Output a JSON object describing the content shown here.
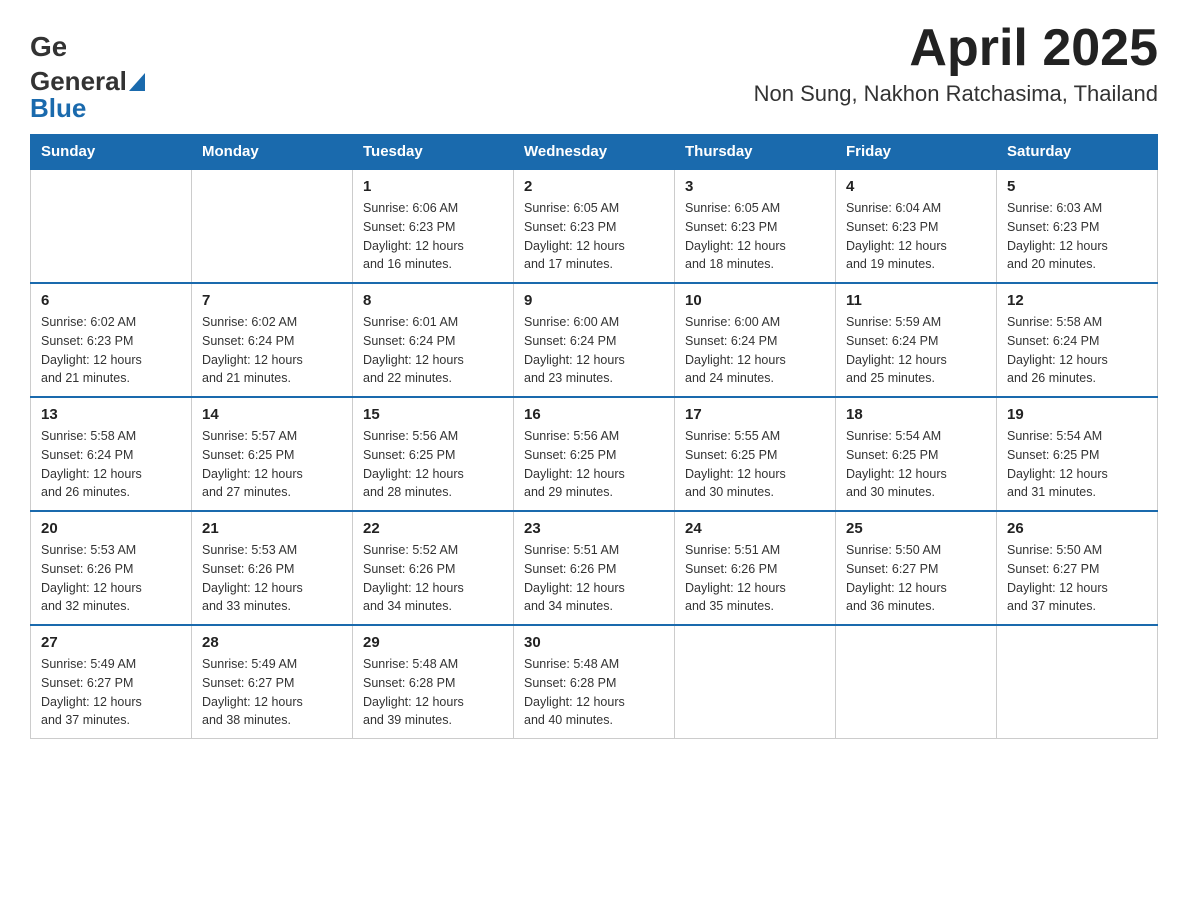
{
  "header": {
    "logo_general": "General",
    "logo_blue": "Blue",
    "title": "April 2025",
    "subtitle": "Non Sung, Nakhon Ratchasima, Thailand"
  },
  "calendar": {
    "headers": [
      "Sunday",
      "Monday",
      "Tuesday",
      "Wednesday",
      "Thursday",
      "Friday",
      "Saturday"
    ],
    "weeks": [
      [
        {
          "day": "",
          "info": ""
        },
        {
          "day": "",
          "info": ""
        },
        {
          "day": "1",
          "info": "Sunrise: 6:06 AM\nSunset: 6:23 PM\nDaylight: 12 hours\nand 16 minutes."
        },
        {
          "day": "2",
          "info": "Sunrise: 6:05 AM\nSunset: 6:23 PM\nDaylight: 12 hours\nand 17 minutes."
        },
        {
          "day": "3",
          "info": "Sunrise: 6:05 AM\nSunset: 6:23 PM\nDaylight: 12 hours\nand 18 minutes."
        },
        {
          "day": "4",
          "info": "Sunrise: 6:04 AM\nSunset: 6:23 PM\nDaylight: 12 hours\nand 19 minutes."
        },
        {
          "day": "5",
          "info": "Sunrise: 6:03 AM\nSunset: 6:23 PM\nDaylight: 12 hours\nand 20 minutes."
        }
      ],
      [
        {
          "day": "6",
          "info": "Sunrise: 6:02 AM\nSunset: 6:23 PM\nDaylight: 12 hours\nand 21 minutes."
        },
        {
          "day": "7",
          "info": "Sunrise: 6:02 AM\nSunset: 6:24 PM\nDaylight: 12 hours\nand 21 minutes."
        },
        {
          "day": "8",
          "info": "Sunrise: 6:01 AM\nSunset: 6:24 PM\nDaylight: 12 hours\nand 22 minutes."
        },
        {
          "day": "9",
          "info": "Sunrise: 6:00 AM\nSunset: 6:24 PM\nDaylight: 12 hours\nand 23 minutes."
        },
        {
          "day": "10",
          "info": "Sunrise: 6:00 AM\nSunset: 6:24 PM\nDaylight: 12 hours\nand 24 minutes."
        },
        {
          "day": "11",
          "info": "Sunrise: 5:59 AM\nSunset: 6:24 PM\nDaylight: 12 hours\nand 25 minutes."
        },
        {
          "day": "12",
          "info": "Sunrise: 5:58 AM\nSunset: 6:24 PM\nDaylight: 12 hours\nand 26 minutes."
        }
      ],
      [
        {
          "day": "13",
          "info": "Sunrise: 5:58 AM\nSunset: 6:24 PM\nDaylight: 12 hours\nand 26 minutes."
        },
        {
          "day": "14",
          "info": "Sunrise: 5:57 AM\nSunset: 6:25 PM\nDaylight: 12 hours\nand 27 minutes."
        },
        {
          "day": "15",
          "info": "Sunrise: 5:56 AM\nSunset: 6:25 PM\nDaylight: 12 hours\nand 28 minutes."
        },
        {
          "day": "16",
          "info": "Sunrise: 5:56 AM\nSunset: 6:25 PM\nDaylight: 12 hours\nand 29 minutes."
        },
        {
          "day": "17",
          "info": "Sunrise: 5:55 AM\nSunset: 6:25 PM\nDaylight: 12 hours\nand 30 minutes."
        },
        {
          "day": "18",
          "info": "Sunrise: 5:54 AM\nSunset: 6:25 PM\nDaylight: 12 hours\nand 30 minutes."
        },
        {
          "day": "19",
          "info": "Sunrise: 5:54 AM\nSunset: 6:25 PM\nDaylight: 12 hours\nand 31 minutes."
        }
      ],
      [
        {
          "day": "20",
          "info": "Sunrise: 5:53 AM\nSunset: 6:26 PM\nDaylight: 12 hours\nand 32 minutes."
        },
        {
          "day": "21",
          "info": "Sunrise: 5:53 AM\nSunset: 6:26 PM\nDaylight: 12 hours\nand 33 minutes."
        },
        {
          "day": "22",
          "info": "Sunrise: 5:52 AM\nSunset: 6:26 PM\nDaylight: 12 hours\nand 34 minutes."
        },
        {
          "day": "23",
          "info": "Sunrise: 5:51 AM\nSunset: 6:26 PM\nDaylight: 12 hours\nand 34 minutes."
        },
        {
          "day": "24",
          "info": "Sunrise: 5:51 AM\nSunset: 6:26 PM\nDaylight: 12 hours\nand 35 minutes."
        },
        {
          "day": "25",
          "info": "Sunrise: 5:50 AM\nSunset: 6:27 PM\nDaylight: 12 hours\nand 36 minutes."
        },
        {
          "day": "26",
          "info": "Sunrise: 5:50 AM\nSunset: 6:27 PM\nDaylight: 12 hours\nand 37 minutes."
        }
      ],
      [
        {
          "day": "27",
          "info": "Sunrise: 5:49 AM\nSunset: 6:27 PM\nDaylight: 12 hours\nand 37 minutes."
        },
        {
          "day": "28",
          "info": "Sunrise: 5:49 AM\nSunset: 6:27 PM\nDaylight: 12 hours\nand 38 minutes."
        },
        {
          "day": "29",
          "info": "Sunrise: 5:48 AM\nSunset: 6:28 PM\nDaylight: 12 hours\nand 39 minutes."
        },
        {
          "day": "30",
          "info": "Sunrise: 5:48 AM\nSunset: 6:28 PM\nDaylight: 12 hours\nand 40 minutes."
        },
        {
          "day": "",
          "info": ""
        },
        {
          "day": "",
          "info": ""
        },
        {
          "day": "",
          "info": ""
        }
      ]
    ]
  }
}
